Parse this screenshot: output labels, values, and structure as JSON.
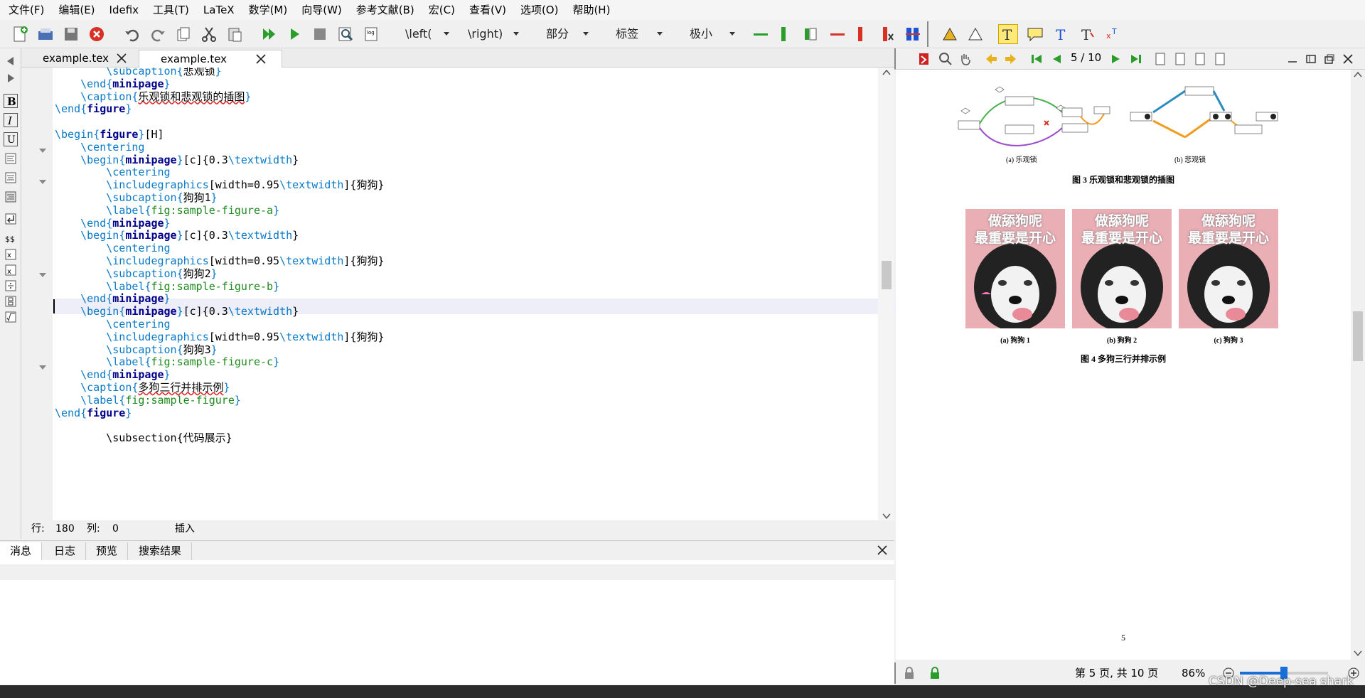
{
  "menu": [
    "文件(F)",
    "编辑(E)",
    "Idefix",
    "工具(T)",
    "LaTeX",
    "数学(M)",
    "向导(W)",
    "参考文献(B)",
    "宏(C)",
    "查看(V)",
    "选项(O)",
    "帮助(H)"
  ],
  "toolbar": {
    "left_label": "\\left(",
    "right_label": "\\right)",
    "section": "部分",
    "label": "标签",
    "size": "极小"
  },
  "tabs": [
    "example.tex",
    "example.tex"
  ],
  "code_lines": [
    {
      "indent": "        ",
      "parts": [
        [
          "bl",
          "\\subcaption"
        ],
        [
          "br",
          "{"
        ],
        [
          "pl",
          "悲观锁"
        ],
        [
          "br",
          "}"
        ]
      ]
    },
    {
      "indent": "    ",
      "parts": [
        [
          "bl",
          "\\end"
        ],
        [
          "br",
          "{"
        ],
        [
          "bf",
          "minipage"
        ],
        [
          "br",
          "}"
        ]
      ]
    },
    {
      "indent": "    ",
      "parts": [
        [
          "bl",
          "\\caption"
        ],
        [
          "br",
          "{"
        ],
        [
          "sq",
          "乐观锁和悲观锁的插图"
        ],
        [
          "br",
          "}"
        ]
      ]
    },
    {
      "indent": "",
      "parts": [
        [
          "bl",
          "\\end"
        ],
        [
          "br",
          "{"
        ],
        [
          "bf",
          "figure"
        ],
        [
          "br",
          "}"
        ]
      ]
    },
    {
      "indent": "",
      "parts": []
    },
    {
      "indent": "",
      "parts": [
        [
          "bl",
          "\\begin"
        ],
        [
          "br",
          "{"
        ],
        [
          "bf",
          "figure"
        ],
        [
          "br",
          "}"
        ],
        [
          "pl",
          "[H]"
        ]
      ]
    },
    {
      "indent": "    ",
      "parts": [
        [
          "bl",
          "\\centering"
        ]
      ]
    },
    {
      "indent": "    ",
      "parts": [
        [
          "bl",
          "\\begin"
        ],
        [
          "br",
          "{"
        ],
        [
          "bf",
          "minipage"
        ],
        [
          "br",
          "}"
        ],
        [
          "pl",
          "[c]{0.3"
        ],
        [
          "bl",
          "\\textwidth"
        ],
        [
          "pl",
          "}"
        ]
      ]
    },
    {
      "indent": "        ",
      "parts": [
        [
          "bl",
          "\\centering"
        ]
      ]
    },
    {
      "indent": "        ",
      "parts": [
        [
          "bl",
          "\\includegraphics"
        ],
        [
          "pl",
          "[width=0.95"
        ],
        [
          "bl",
          "\\textwidth"
        ],
        [
          "pl",
          "]{狗狗}"
        ]
      ]
    },
    {
      "indent": "        ",
      "parts": [
        [
          "bl",
          "\\subcaption"
        ],
        [
          "br",
          "{"
        ],
        [
          "pl",
          "狗狗1"
        ],
        [
          "br",
          "}"
        ]
      ]
    },
    {
      "indent": "        ",
      "parts": [
        [
          "bl",
          "\\label"
        ],
        [
          "br",
          "{"
        ],
        [
          "gr",
          "fig:sample-figure-a"
        ],
        [
          "br",
          "}"
        ]
      ]
    },
    {
      "indent": "    ",
      "parts": [
        [
          "bl",
          "\\end"
        ],
        [
          "br",
          "{"
        ],
        [
          "bf",
          "minipage"
        ],
        [
          "br",
          "}"
        ]
      ]
    },
    {
      "indent": "    ",
      "parts": [
        [
          "bl",
          "\\begin"
        ],
        [
          "br",
          "{"
        ],
        [
          "bf",
          "minipage"
        ],
        [
          "br",
          "}"
        ],
        [
          "pl",
          "[c]{0.3"
        ],
        [
          "bl",
          "\\textwidth"
        ],
        [
          "pl",
          "}"
        ]
      ]
    },
    {
      "indent": "        ",
      "parts": [
        [
          "bl",
          "\\centering"
        ]
      ]
    },
    {
      "indent": "        ",
      "parts": [
        [
          "bl",
          "\\includegraphics"
        ],
        [
          "pl",
          "[width=0.95"
        ],
        [
          "bl",
          "\\textwidth"
        ],
        [
          "pl",
          "]{狗狗}"
        ]
      ]
    },
    {
      "indent": "        ",
      "parts": [
        [
          "bl",
          "\\subcaption"
        ],
        [
          "br",
          "{"
        ],
        [
          "pl",
          "狗狗2"
        ],
        [
          "br",
          "}"
        ]
      ]
    },
    {
      "indent": "        ",
      "parts": [
        [
          "bl",
          "\\label"
        ],
        [
          "br",
          "{"
        ],
        [
          "gr",
          "fig:sample-figure-b"
        ],
        [
          "br",
          "}"
        ]
      ]
    },
    {
      "indent": "    ",
      "parts": [
        [
          "bl",
          "\\end"
        ],
        [
          "br",
          "{"
        ],
        [
          "bf",
          "minipage"
        ],
        [
          "br",
          "}"
        ]
      ]
    },
    {
      "indent": "    ",
      "parts": [
        [
          "bl",
          "\\begin"
        ],
        [
          "br",
          "{"
        ],
        [
          "bf",
          "minipage"
        ],
        [
          "br",
          "}"
        ],
        [
          "pl",
          "[c]{0.3"
        ],
        [
          "bl",
          "\\textwidth"
        ],
        [
          "pl",
          "}"
        ]
      ]
    },
    {
      "indent": "        ",
      "parts": [
        [
          "bl",
          "\\centering"
        ]
      ]
    },
    {
      "indent": "        ",
      "parts": [
        [
          "bl",
          "\\includegraphics"
        ],
        [
          "pl",
          "[width=0.95"
        ],
        [
          "bl",
          "\\textwidth"
        ],
        [
          "pl",
          "]{狗狗}"
        ]
      ]
    },
    {
      "indent": "        ",
      "parts": [
        [
          "bl",
          "\\subcaption"
        ],
        [
          "br",
          "{"
        ],
        [
          "pl",
          "狗狗3"
        ],
        [
          "br",
          "}"
        ]
      ]
    },
    {
      "indent": "        ",
      "parts": [
        [
          "bl",
          "\\label"
        ],
        [
          "br",
          "{"
        ],
        [
          "gr",
          "fig:sample-figure-c"
        ],
        [
          "br",
          "}"
        ]
      ]
    },
    {
      "indent": "    ",
      "parts": [
        [
          "bl",
          "\\end"
        ],
        [
          "br",
          "{"
        ],
        [
          "bf",
          "minipage"
        ],
        [
          "br",
          "}"
        ]
      ]
    },
    {
      "indent": "    ",
      "parts": [
        [
          "bl",
          "\\caption"
        ],
        [
          "br",
          "{"
        ],
        [
          "sq",
          "多狗三行并排示例"
        ],
        [
          "br",
          "}"
        ]
      ]
    },
    {
      "indent": "    ",
      "parts": [
        [
          "bl",
          "\\label"
        ],
        [
          "br",
          "{"
        ],
        [
          "gr",
          "fig:sample-figure"
        ],
        [
          "br",
          "}"
        ]
      ]
    },
    {
      "indent": "",
      "parts": [
        [
          "bl",
          "\\end"
        ],
        [
          "br",
          "{"
        ],
        [
          "bf",
          "figure"
        ],
        [
          "br",
          "}"
        ]
      ]
    },
    {
      "indent": "",
      "parts": []
    },
    {
      "indent": "        ",
      "parts": [
        [
          "pl",
          "\\subsection{代码展示}"
        ]
      ]
    }
  ],
  "status": {
    "row_label": "行:",
    "row": "180",
    "col_label": "列:",
    "col": "0",
    "mode": "插入"
  },
  "bottom_tabs": [
    "消息",
    "日志",
    "预览",
    "搜索结果"
  ],
  "preview": {
    "page_indicator": "5 / 10",
    "fig3_sub_a": "(a) 乐观锁",
    "fig3_sub_b": "(b) 悲观锁",
    "fig3_caption": "图 3    乐观锁和悲观锁的插图",
    "dog_text_1": "做舔狗呢",
    "dog_text_2": "最重要是开心",
    "fig4_sub": [
      "(a) 狗狗 1",
      "(b) 狗狗 2",
      "(c) 狗狗 3"
    ],
    "fig4_caption": "图 4    多狗三行并排示例",
    "page_number": "5",
    "page_status": "第 5 页, 共 10 页",
    "zoom": "86%",
    "zoom_level": 0.5
  },
  "watermark": "CSDN @Deep-sea shark",
  "colors": {
    "keyword": "#0a7ac8",
    "env": "#00008b",
    "label": "#1e8a1e",
    "squiggle": "#e02020"
  }
}
